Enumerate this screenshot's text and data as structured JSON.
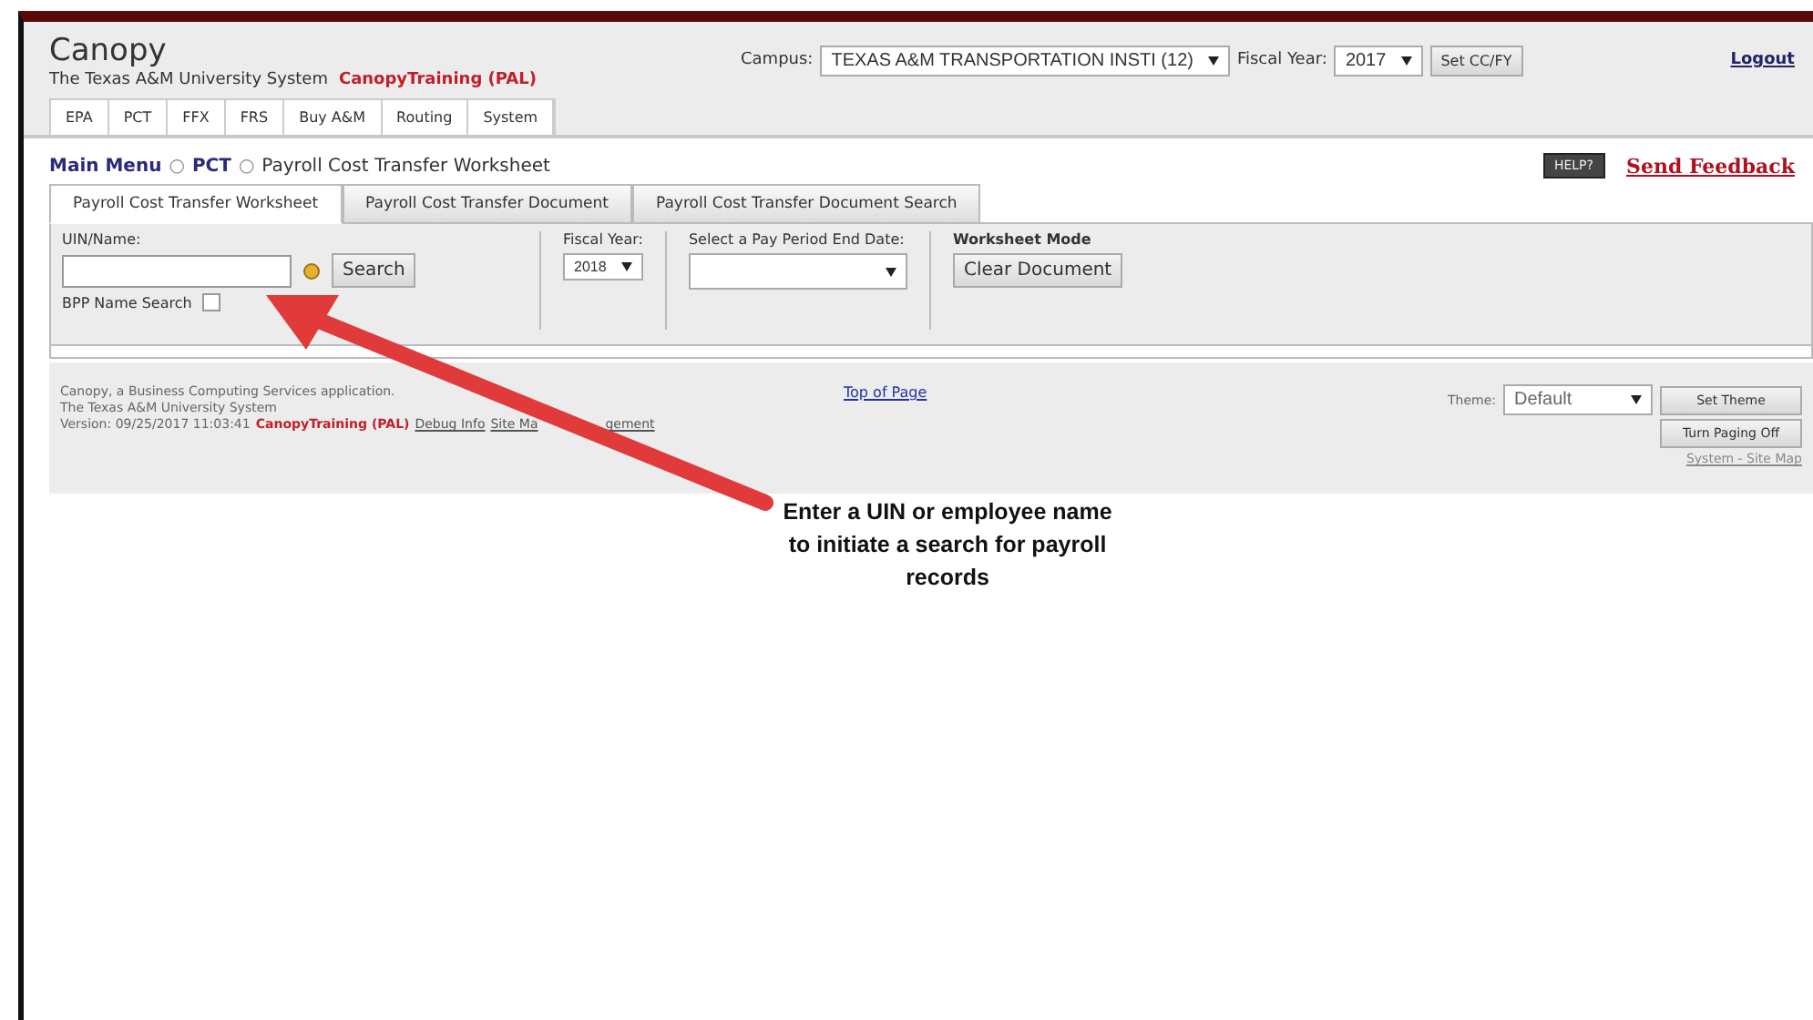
{
  "header": {
    "app_title": "Canopy",
    "subtitle": "The Texas A&M University System",
    "environment": "CanopyTraining (PAL)",
    "campus_label": "Campus:",
    "campus_value": "TEXAS A&M TRANSPORTATION INSTI (12)",
    "fiscal_year_label": "Fiscal Year:",
    "fiscal_year_value": "2017",
    "set_button": "Set CC/FY",
    "logout": "Logout"
  },
  "nav_tabs": [
    {
      "label": "EPA"
    },
    {
      "label": "PCT"
    },
    {
      "label": "FFX"
    },
    {
      "label": "FRS"
    },
    {
      "label": "Buy A&M"
    },
    {
      "label": "Routing"
    },
    {
      "label": "System"
    }
  ],
  "breadcrumb": {
    "main_menu": "Main Menu",
    "separator": "○",
    "module": "PCT",
    "current": "Payroll Cost Transfer Worksheet"
  },
  "help": "HELP?",
  "send_feedback": "Send Feedback",
  "tabs": [
    {
      "label": "Payroll Cost Transfer Worksheet",
      "selected": true
    },
    {
      "label": "Payroll Cost Transfer Document",
      "selected": false
    },
    {
      "label": "Payroll Cost Transfer Document Search",
      "selected": false
    }
  ],
  "form": {
    "uin_label": "UIN/Name:",
    "search_button": "Search",
    "bpp_label": "BPP Name Search",
    "bpp_checked": false,
    "fy_label": "Fiscal Year:",
    "fy_value": "2018",
    "pay_period_label": "Select a Pay Period End Date:",
    "mode_label": "Worksheet Mode",
    "clear_button": "Clear Document"
  },
  "footer": {
    "line1": "Canopy, a Business Computing Services application.",
    "line2": "The Texas A&M University System",
    "version": "Version: 09/25/2017 11:03:41",
    "environment": "CanopyTraining (PAL)",
    "debug_link": "Debug Info",
    "site_link_parts": [
      "Site Ma",
      "gement"
    ],
    "top_link": "Top of Page",
    "theme_label": "Theme:",
    "theme_value": "Default",
    "set_theme": "Set Theme",
    "paging": "Turn Paging Off",
    "site_map": "System - Site Map"
  },
  "callout": "Enter a UIN or employee name to initiate a search for payroll records"
}
